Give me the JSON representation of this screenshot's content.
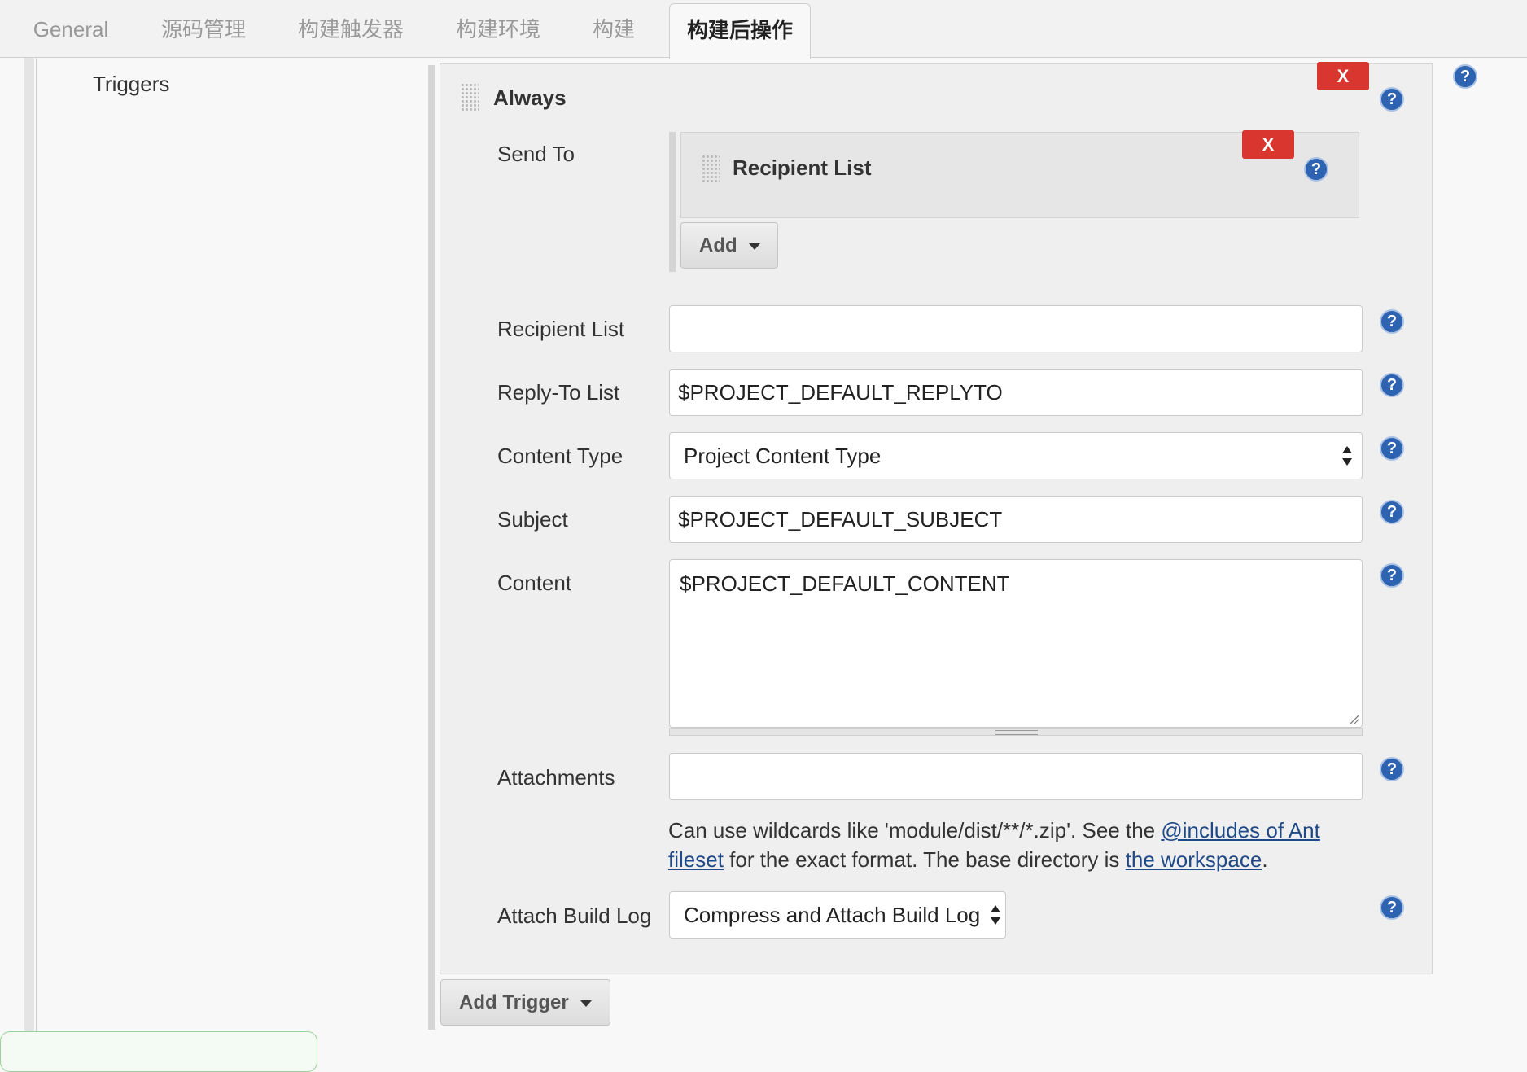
{
  "tabs": [
    {
      "label": "General"
    },
    {
      "label": "源码管理"
    },
    {
      "label": "构建触发器"
    },
    {
      "label": "构建环境"
    },
    {
      "label": "构建"
    },
    {
      "label": "构建后操作"
    }
  ],
  "sidebar": {
    "triggers_label": "Triggers"
  },
  "trigger": {
    "title": "Always",
    "remove_label": "X",
    "send_to": {
      "label": "Send To",
      "recipient_panel": {
        "title": "Recipient List",
        "remove_label": "X"
      },
      "add_button": "Add"
    },
    "fields": {
      "recipient_list": {
        "label": "Recipient List",
        "value": ""
      },
      "reply_to": {
        "label": "Reply-To List",
        "value": "$PROJECT_DEFAULT_REPLYTO"
      },
      "content_type": {
        "label": "Content Type",
        "selected": "Project Content Type"
      },
      "subject": {
        "label": "Subject",
        "value": "$PROJECT_DEFAULT_SUBJECT"
      },
      "content": {
        "label": "Content",
        "value": "$PROJECT_DEFAULT_CONTENT"
      },
      "attachments": {
        "label": "Attachments",
        "value": ""
      },
      "attach_build_log": {
        "label": "Attach Build Log",
        "selected": "Compress and Attach Build Log"
      }
    },
    "attachments_hint": {
      "prefix": "Can use wildcards like 'module/dist/**/*.zip'. See the ",
      "link1": "@includes of Ant fileset",
      "middle": " for the exact format. The base directory is ",
      "link2": "the workspace",
      "suffix": "."
    }
  },
  "add_trigger_button": "Add Trigger",
  "help_glyph": "?",
  "colors": {
    "remove_button": "#d9362f",
    "help_icon": "#2d63b0",
    "link": "#204a87"
  }
}
